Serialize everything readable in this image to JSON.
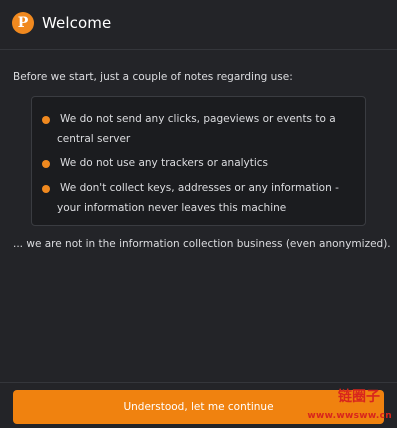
{
  "header": {
    "logo_icon": "polkadot-p-icon",
    "logo_letter": "P",
    "title": "Welcome"
  },
  "main": {
    "intro": "Before we start, just a couple of notes regarding use:",
    "notes": [
      "We do not send any clicks, pageviews or events to a central server",
      "We do not use any trackers or analytics",
      "We don't collect keys, addresses or any information - your information never leaves this machine"
    ],
    "outro": "... we are not in the information collection business (even anonymized)."
  },
  "footer": {
    "continue_label": "Understood, let me continue"
  },
  "watermark": {
    "text": "链圈子",
    "url": "www.wwsww.cn"
  },
  "colors": {
    "background": "#232428",
    "box": "#1b1c1f",
    "accent": "#f0820f",
    "watermark": "#d8251d"
  }
}
